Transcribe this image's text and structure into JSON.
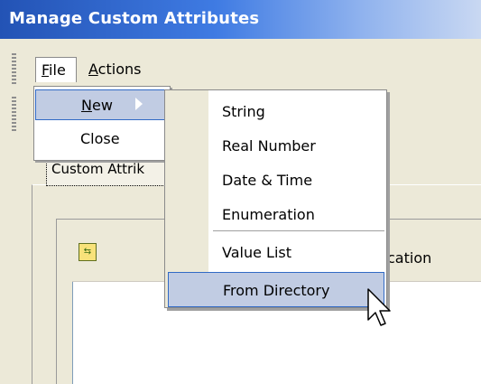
{
  "window": {
    "title": "Manage Custom Attributes"
  },
  "menubar": {
    "file": "File",
    "file_key": "F",
    "file_rest": "ile",
    "actions": "Actions",
    "actions_key": "A",
    "actions_rest": "ctions"
  },
  "file_menu": [
    {
      "label": "New",
      "key": "N",
      "rest": "ew",
      "highlighted": true,
      "has_submenu": true
    },
    {
      "label": "Close",
      "highlighted": false
    }
  ],
  "new_submenu": [
    {
      "label": "String"
    },
    {
      "label": "Real Number"
    },
    {
      "label": "Date & Time"
    },
    {
      "label": "Enumeration"
    },
    {
      "label": "Value List"
    },
    {
      "label": "From Directory",
      "highlighted": true
    }
  ],
  "tabs": {
    "custom_attributes": "Custom Attrik"
  },
  "list": {
    "header_partial": "cation",
    "header_icon": "tree-icon"
  },
  "toolbar": {
    "help_icon": "help-icon",
    "help_glyph": "?"
  },
  "colors": {
    "title_start": "#2353b5",
    "title_end": "#c9d8f2",
    "highlight": "#c1cce3",
    "highlight_border": "#316ac5",
    "bg": "#ece9d8"
  }
}
